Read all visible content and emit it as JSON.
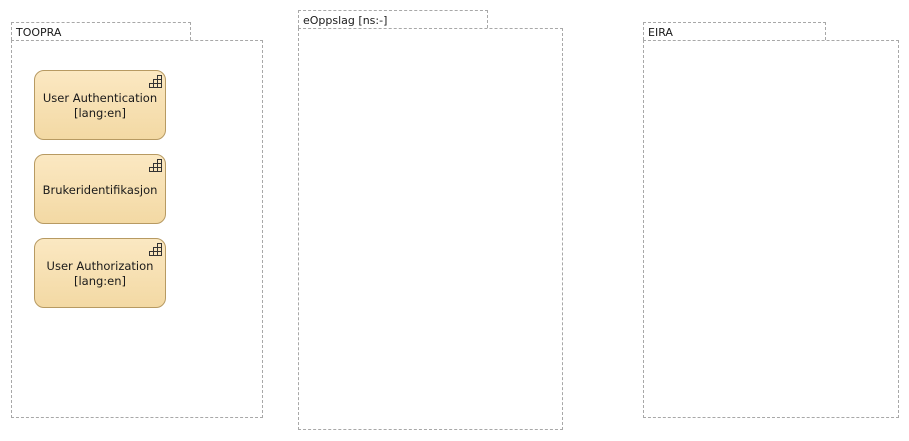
{
  "groups": [
    {
      "label": "TOOPRA",
      "nodes": [
        {
          "lines": [
            "User Authentication",
            "[lang:en]"
          ],
          "icon": "application-function-icon"
        },
        {
          "lines": [
            "Brukeridentifikasjon"
          ],
          "icon": "application-function-icon"
        },
        {
          "lines": [
            "User Authorization",
            "[lang:en]"
          ],
          "icon": "application-function-icon"
        }
      ]
    },
    {
      "label": "eOppslag [ns:-]",
      "nodes": []
    },
    {
      "label": "EIRA",
      "nodes": []
    }
  ],
  "colors": {
    "group_border": "#a8a8a8",
    "node_fill_top": "#fbe8c2",
    "node_fill_bottom": "#f3d9a4",
    "node_border": "#b79a62"
  }
}
